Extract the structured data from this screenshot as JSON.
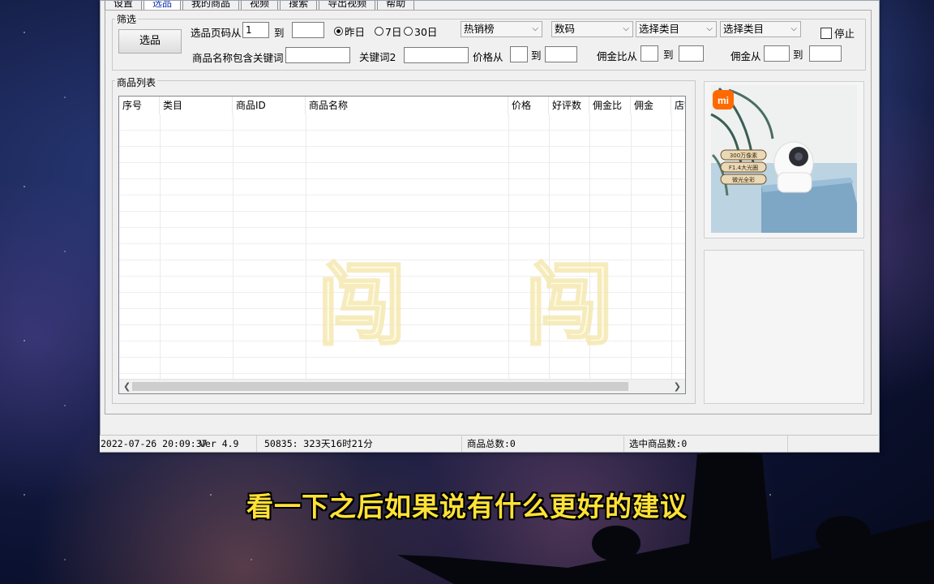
{
  "tabs": [
    "设置",
    "选品",
    "我的商品",
    "视频",
    "搜索",
    "导出视频",
    "帮助"
  ],
  "active_tab": 1,
  "filter": {
    "group_label": "筛选",
    "select_button": "选品",
    "page_from_label": "选品页码从",
    "page_from_value": "1",
    "to_label": "到",
    "page_to_value": "",
    "radios": [
      {
        "label": "昨日",
        "checked": true
      },
      {
        "label": "7日",
        "checked": false
      },
      {
        "label": "30日",
        "checked": false
      }
    ],
    "combo_rank": "热销榜",
    "combo_category": "数码",
    "combo_type1": "选择类目",
    "combo_type2": "选择类目",
    "stop_label": "停止",
    "keyword_label": "商品名称包含关键词",
    "keyword_value": "",
    "keyword2_label": "关键词2",
    "keyword2_value": "",
    "price_from_label": "价格从",
    "commission_rate_label": "佣金比从",
    "commission_label": "佣金从"
  },
  "list": {
    "group_label": "商品列表",
    "columns": [
      "序号",
      "类目",
      "商品ID",
      "商品名称",
      "价格",
      "好评数",
      "佣金比",
      "佣金",
      "店铺"
    ],
    "watermark": "闯"
  },
  "product_image": {
    "brand_icon": "mi-logo-icon",
    "badges": [
      "300万像素",
      "F1.4大光圈",
      "微光全彩"
    ]
  },
  "status_bar": {
    "datetime": "2022-07-26 20:09:37",
    "version": "Ver 4.9",
    "code": "50835:",
    "remaining": "323天16时21分",
    "total_label": "商品总数:0",
    "selected_label": "选中商品数:0"
  },
  "subtitle": "看一下之后如果说有什么更好的建议"
}
